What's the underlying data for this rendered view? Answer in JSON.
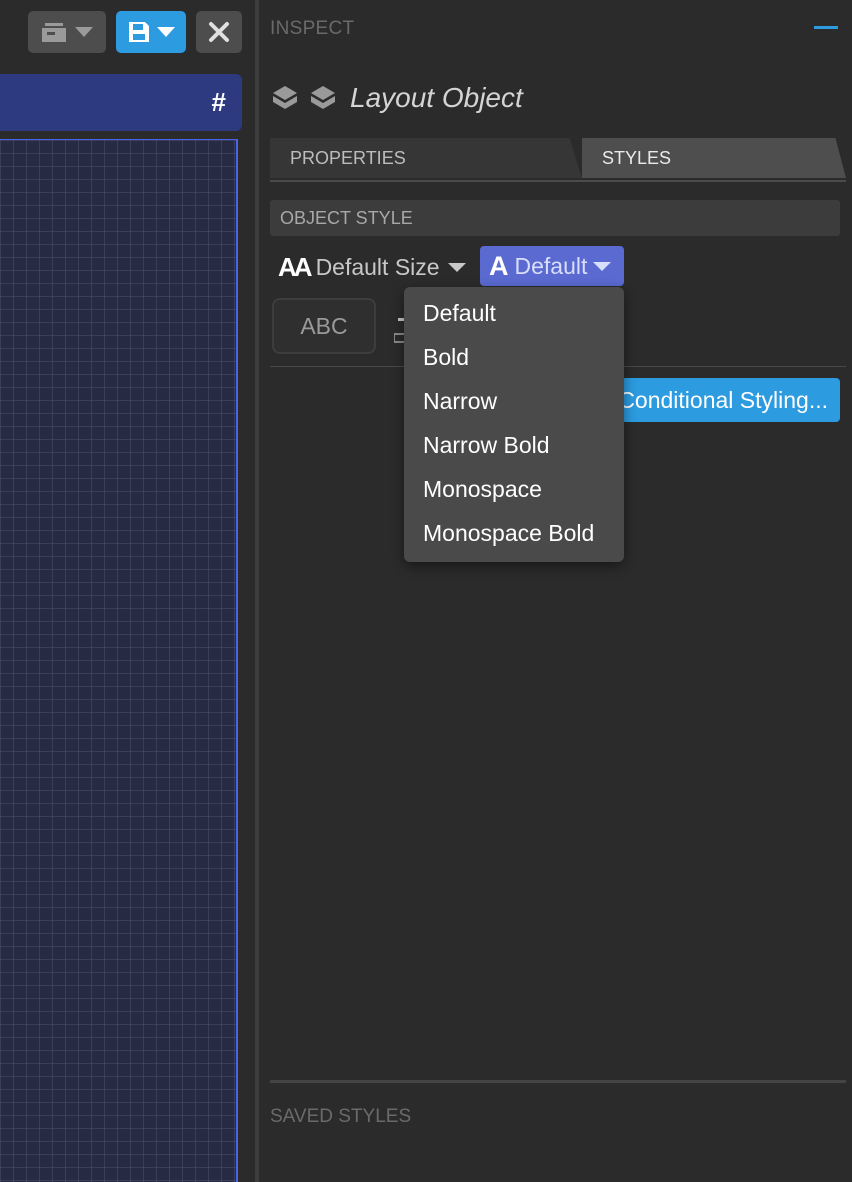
{
  "toolbar": {
    "archive_icon": "archive-icon",
    "save_icon": "save-icon",
    "close_icon": "close-icon",
    "accent_color": "#2c9be0"
  },
  "layout": {
    "header_icon": "hash-icon",
    "hash_symbol": "#",
    "header_color": "#2e3a80",
    "canvas_border_color": "#4a63e8"
  },
  "inspector": {
    "title": "INSPECT",
    "object_title": "Layout Object",
    "tabs": [
      {
        "label": "PROPERTIES",
        "active": false
      },
      {
        "label": "STYLES",
        "active": true
      }
    ],
    "object_style": {
      "heading": "OBJECT STYLE",
      "size_label": "Default Size",
      "size_icon_text": "AA",
      "font_label": "Default",
      "font_icon_text": "A",
      "preview_text": "ABC",
      "conditional_label": "Conditional Styling..."
    },
    "saved_styles": {
      "heading": "SAVED STYLES"
    }
  },
  "font_menu": {
    "items": [
      "Default",
      "Bold",
      "Narrow",
      "Narrow Bold",
      "Monospace",
      "Monospace Bold"
    ]
  }
}
